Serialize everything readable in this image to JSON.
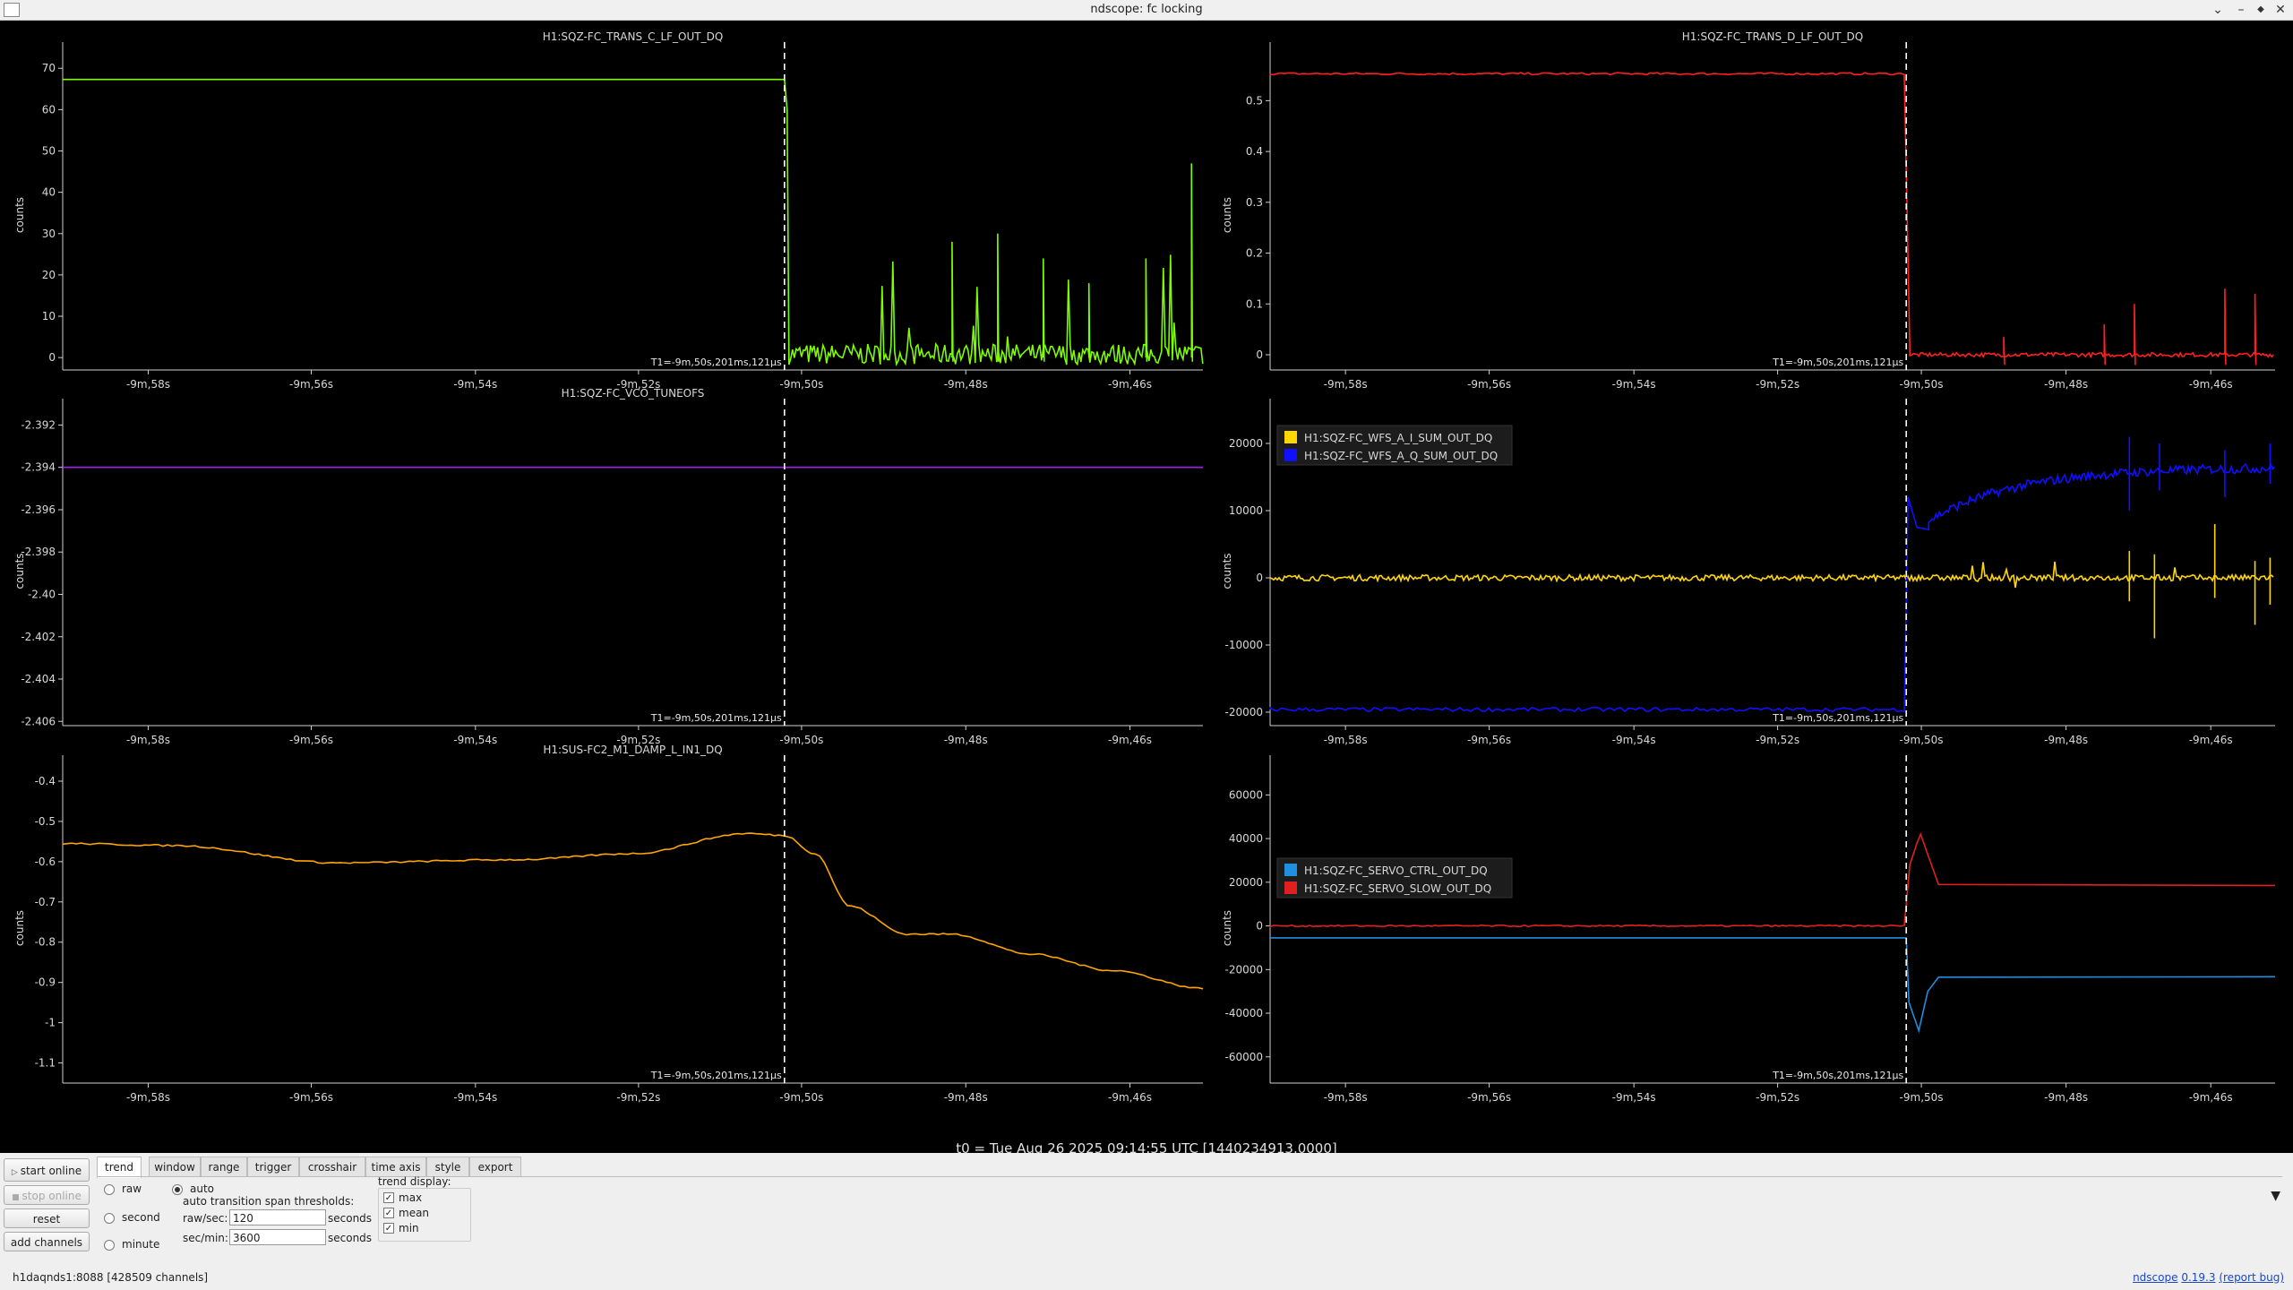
{
  "window": {
    "title": "ndscope: fc locking",
    "minimize": "–",
    "restore": "◆",
    "close": "✕"
  },
  "t0_label": "t0 = Tue Aug 26 2025 09:14:55 UTC [1440234913.0000]",
  "cursor_label": "T1=-9m,50s,201ms,121µs",
  "x_ticks": [
    "-9m,58s",
    "-9m,56s",
    "-9m,54s",
    "-9m,52s",
    "-9m,50s",
    "-9m,48s",
    "-9m,46s"
  ],
  "y_axis_label": "counts",
  "colors": {
    "background": "#000000",
    "axis": "#d0d0d0",
    "cursor": "#ffffff"
  },
  "chart_data": [
    {
      "type": "line",
      "title": "H1:SQZ-FC_TRANS_C_LF_OUT_DQ",
      "ylabel": "counts",
      "ylim": [
        -3,
        72
      ],
      "y_ticks": [
        "70",
        "60",
        "50",
        "40",
        "30",
        "20",
        "10",
        "0"
      ],
      "series": [
        {
          "color": "#7cfc00",
          "description": "flat at ~67 until cursor, drops to ~0 with noise and spikes up to ~47"
        }
      ]
    },
    {
      "type": "line",
      "title": "H1:SQZ-FC_TRANS_D_LF_OUT_DQ",
      "ylabel": "counts",
      "ylim": [
        -0.03,
        0.58
      ],
      "y_ticks": [
        "0.5",
        "0.4",
        "0.3",
        "0.2",
        "0.1",
        "0"
      ],
      "series": [
        {
          "color": "#ff2020",
          "description": "flat at ~0.55 until cursor, drops to ~0"
        }
      ]
    },
    {
      "type": "line",
      "title": "H1:SQZ-FC_VCO_TUNEOFS",
      "ylabel": "counts",
      "ylim": [
        -2.4062,
        -2.3916
      ],
      "y_ticks": [
        "-2.392",
        "-2.394",
        "-2.396",
        "-2.398",
        "-2.40",
        "-2.402",
        "-2.404",
        "-2.406"
      ],
      "series": [
        {
          "color": "#a020f0",
          "description": "constant at -2.394"
        }
      ]
    },
    {
      "type": "line",
      "title": "",
      "ylabel": "counts",
      "ylim": [
        -22000,
        24000
      ],
      "y_ticks": [
        "20000",
        "10000",
        "0",
        "-10000",
        "-20000"
      ],
      "series": [
        {
          "name": "H1:SQZ-FC_WFS_A_I_SUM_OUT_DQ",
          "color": "#ffd700"
        },
        {
          "name": "H1:SQZ-FC_WFS_A_Q_SUM_OUT_DQ",
          "color": "#1010ff"
        }
      ]
    },
    {
      "type": "line",
      "title": "H1:SUS-FC2_M1_DAMP_L_IN1_DQ",
      "ylabel": "counts",
      "ylim": [
        -1.15,
        -0.38
      ],
      "y_ticks": [
        "-0.4",
        "-0.5",
        "-0.6",
        "-0.7",
        "-0.8",
        "-0.9",
        "-1",
        "-1.1"
      ],
      "series": [
        {
          "color": "#ffa500",
          "description": "slow drift ~-0.55 to -0.52, then descends to ~-0.92"
        }
      ]
    },
    {
      "type": "line",
      "title": "",
      "ylabel": "counts",
      "ylim": [
        -72000,
        70000
      ],
      "y_ticks": [
        "60000",
        "40000",
        "20000",
        "0",
        "-20000",
        "-40000",
        "-60000"
      ],
      "series": [
        {
          "name": "H1:SQZ-FC_SERVO_CTRL_OUT_DQ",
          "color": "#1f8fe0"
        },
        {
          "name": "H1:SQZ-FC_SERVO_SLOW_OUT_DQ",
          "color": "#e02020"
        }
      ]
    }
  ],
  "controls": {
    "start_online": "start online",
    "stop_online": "stop online",
    "reset": "reset",
    "add_channels": "add channels",
    "tabs": [
      "trend",
      "window",
      "range",
      "trigger",
      "crosshair",
      "time axis",
      "style",
      "export"
    ],
    "trend": {
      "raw": "raw",
      "second": "second",
      "minute": "minute",
      "auto": "auto",
      "thresholds_label": "auto transition span thresholds:",
      "raw_sec_label": "raw/sec:",
      "raw_sec_value": "120",
      "sec_min_label": "sec/min:",
      "sec_min_value": "3600",
      "seconds": "seconds",
      "display_label": "trend display:",
      "max": "max",
      "mean": "mean",
      "min": "min",
      "check": "✓"
    },
    "expand": "▼"
  },
  "status": {
    "server": "h1daqnds1:8088",
    "channels": "[428509 channels]",
    "ndscope_link": "ndscope",
    "version_link": "0.19.3",
    "report_bug": "(report bug)"
  }
}
